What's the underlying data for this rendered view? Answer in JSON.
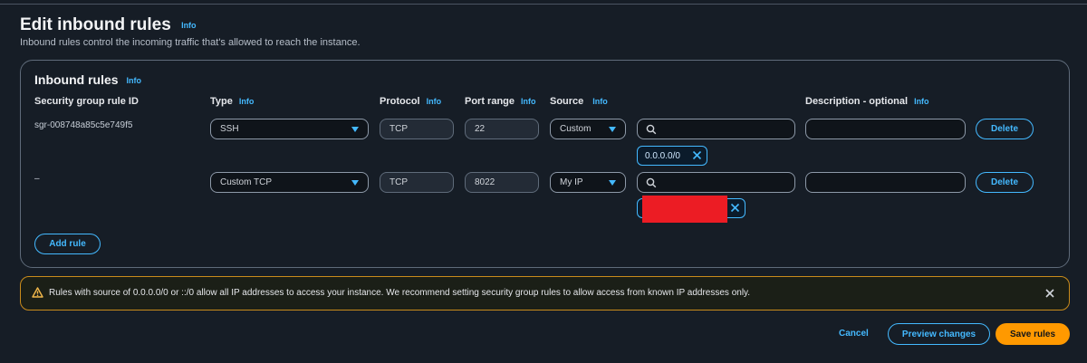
{
  "page": {
    "title": "Edit inbound rules",
    "info_label": "Info",
    "description": "Inbound rules control the incoming traffic that's allowed to reach the instance."
  },
  "panel": {
    "title": "Inbound rules",
    "info_label": "Info",
    "columns": {
      "rule_id": "Security group rule ID",
      "type": "Type",
      "protocol": "Protocol",
      "port_range": "Port range",
      "source": "Source",
      "description": "Description - optional"
    },
    "rows": [
      {
        "rule_id": "sgr-008748a85c5e749f5",
        "type": "SSH",
        "protocol": "TCP",
        "port_range": "22",
        "source": "Custom",
        "search_value": "",
        "token": "0.0.0.0/0",
        "description": "",
        "delete_label": "Delete"
      },
      {
        "rule_id": "–",
        "type": "Custom TCP",
        "protocol": "TCP",
        "port_range": "8022",
        "source": "My IP",
        "search_value": "",
        "token": "",
        "description": "",
        "delete_label": "Delete"
      }
    ],
    "add_rule_label": "Add rule"
  },
  "alert": {
    "text": "Rules with source of 0.0.0.0/0 or ::/0 allow all IP addresses to access your instance. We recommend setting security group rules to allow access from known IP addresses only.",
    "icon": "warning-icon",
    "close_icon": "close-icon"
  },
  "footer": {
    "cancel_label": "Cancel",
    "preview_label": "Preview changes",
    "save_label": "Save rules"
  },
  "colors": {
    "background": "#161d26",
    "accent": "#44b9ff",
    "primary_button": "#ff9900",
    "warning_border": "#c98b1b",
    "redaction": "#ec1c24"
  }
}
